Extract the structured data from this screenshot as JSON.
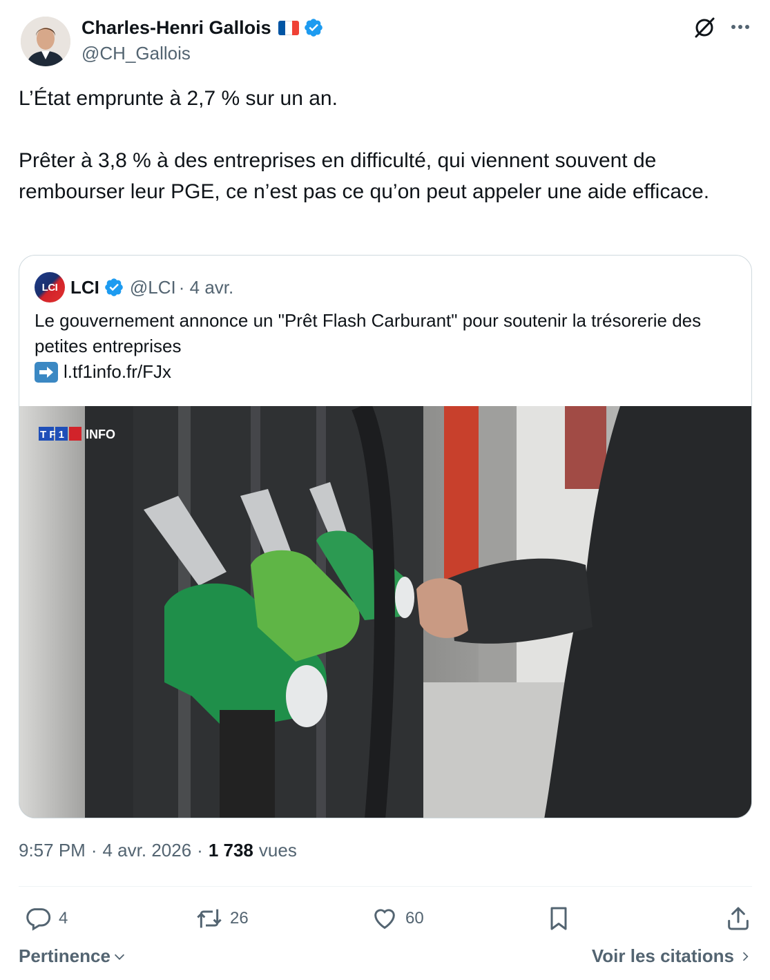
{
  "author": {
    "name": "Charles-Henri Gallois",
    "handle": "@CH_Gallois",
    "flag_colors": [
      "#0055a4",
      "#ffffff",
      "#ef4135"
    ],
    "verified": true
  },
  "tweet": {
    "paragraphs": [
      "L’État emprunte à 2,7 % sur un an.",
      "Prêter à 3,8 % à des entreprises en difficulté, qui viennent souvent de rembourser leur PGE, ce n’est pas ce qu’on peut appeler une aide efficace."
    ],
    "time": "9:57 PM",
    "separator": "·",
    "date": "4 avr. 2026",
    "views_count": "1 738",
    "views_label": "vues"
  },
  "quote": {
    "logo_text": "LCI",
    "name": "LCI",
    "handle": "@LCI",
    "date": "· 4 avr.",
    "text": "Le gouvernement annonce un \"Prêt Flash Carburant\" pour soutenir la trésorerie des petites entreprises",
    "link": "l.tf1info.fr/FJx",
    "image_watermark": "TF1 INFO"
  },
  "actions": {
    "replies": "4",
    "reposts": "26",
    "likes": "60"
  },
  "footer": {
    "sort_label": "Pertinence",
    "quotes_label": "Voir les citations"
  },
  "colors": {
    "verified_blue": "#1d9bf0",
    "secondary_text": "#536471",
    "primary_text": "#0f1419",
    "border": "#cfd9de"
  }
}
